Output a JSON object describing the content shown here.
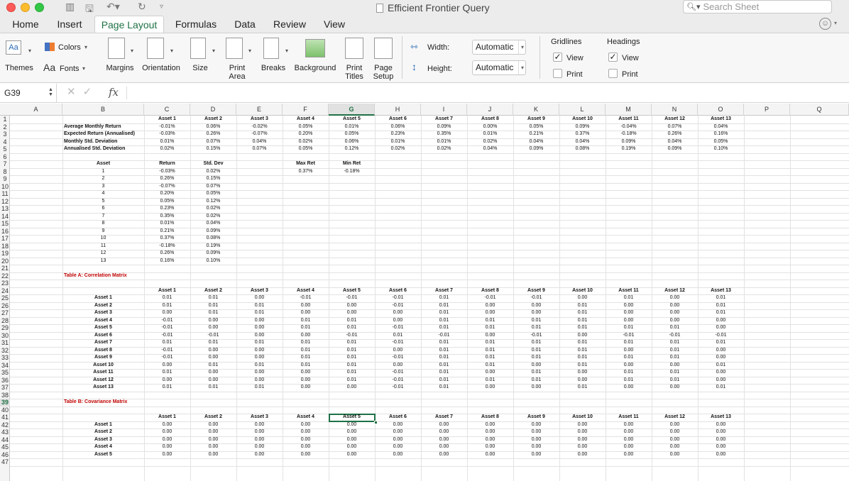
{
  "window": {
    "title": "Efficient Frontier Query"
  },
  "search": {
    "placeholder": "Search Sheet"
  },
  "ribbon_tabs": [
    "Home",
    "Insert",
    "Page Layout",
    "Formulas",
    "Data",
    "Review",
    "View"
  ],
  "active_tab": "Page Layout",
  "ribbon": {
    "themes": "Themes",
    "colors": "Colors",
    "fonts": "Fonts",
    "margins": "Margins",
    "orientation": "Orientation",
    "size": "Size",
    "print_area": "Print Area",
    "breaks": "Breaks",
    "background": "Background",
    "print_titles": "Print Titles",
    "page_setup": "Page Setup",
    "width_label": "Width:",
    "width_value": "Automatic",
    "height_label": "Height:",
    "height_value": "Automatic",
    "gridlines": "Gridlines",
    "headings": "Headings",
    "view": "View",
    "print": "Print",
    "gridlines_view_checked": true,
    "gridlines_print_checked": false,
    "headings_view_checked": true,
    "headings_print_checked": false
  },
  "formula_bar": {
    "name_box": "G39",
    "fx": "fx",
    "value": ""
  },
  "columns": [
    "A",
    "B",
    "C",
    "D",
    "E",
    "F",
    "G",
    "H",
    "I",
    "J",
    "K",
    "L",
    "M",
    "N",
    "O",
    "P",
    "Q"
  ],
  "selected_column": "G",
  "selected_row": "39",
  "rows": [
    "1",
    "2",
    "3",
    "4",
    "5",
    "6",
    "7",
    "8",
    "9",
    "10",
    "11",
    "12",
    "13",
    "14",
    "15",
    "16",
    "17",
    "18",
    "19",
    "20",
    "21",
    "22",
    "23",
    "24",
    "25",
    "26",
    "27",
    "28",
    "29",
    "30",
    "31",
    "32",
    "33",
    "34",
    "35",
    "36",
    "37",
    "38",
    "39",
    "40",
    "41",
    "42",
    "43",
    "44",
    "45",
    "46",
    "47"
  ],
  "assets": [
    "Asset 1",
    "Asset 2",
    "Asset 3",
    "Asset 4",
    "Asset 5",
    "Asset 6",
    "Asset 7",
    "Asset 8",
    "Asset 9",
    "Asset 10",
    "Asset 11",
    "Asset 12",
    "Asset 13"
  ],
  "stats": {
    "labels": [
      "Average Monthly Return",
      "Expected Return (Annualised)",
      "Monthly Std. Deviation",
      "Annualised Std. Deviation"
    ],
    "values": [
      [
        "-0.01%",
        "0.06%",
        "-0.02%",
        "0.05%",
        "0.01%",
        "0.06%",
        "0.09%",
        "0.00%",
        "0.05%",
        "0.09%",
        "-0.04%",
        "0.07%",
        "0.04%"
      ],
      [
        "-0.03%",
        "0.26%",
        "-0.07%",
        "0.20%",
        "0.05%",
        "0.23%",
        "0.35%",
        "0.01%",
        "0.21%",
        "0.37%",
        "-0.18%",
        "0.26%",
        "0.16%"
      ],
      [
        "0.01%",
        "0.07%",
        "0.04%",
        "0.02%",
        "0.06%",
        "0.01%",
        "0.01%",
        "0.02%",
        "0.04%",
        "0.04%",
        "0.09%",
        "0.04%",
        "0.05%"
      ],
      [
        "0.02%",
        "0.15%",
        "0.07%",
        "0.05%",
        "0.12%",
        "0.02%",
        "0.02%",
        "0.04%",
        "0.09%",
        "0.08%",
        "0.19%",
        "0.09%",
        "0.10%"
      ]
    ]
  },
  "summary": {
    "header_asset": "Asset",
    "header_return": "Return",
    "header_std": "Std. Dev",
    "header_max": "Max Ret",
    "header_min": "Min Ret",
    "max_ret": "0.37%",
    "min_ret": "-0.18%",
    "rows": [
      [
        "1",
        "-0.03%",
        "0.02%"
      ],
      [
        "2",
        "0.26%",
        "0.15%"
      ],
      [
        "3",
        "-0.07%",
        "0.07%"
      ],
      [
        "4",
        "0.20%",
        "0.05%"
      ],
      [
        "5",
        "0.05%",
        "0.12%"
      ],
      [
        "6",
        "0.23%",
        "0.02%"
      ],
      [
        "7",
        "0.35%",
        "0.02%"
      ],
      [
        "8",
        "0.01%",
        "0.04%"
      ],
      [
        "9",
        "0.21%",
        "0.09%"
      ],
      [
        "10",
        "0.37%",
        "0.08%"
      ],
      [
        "11",
        "-0.18%",
        "0.19%"
      ],
      [
        "12",
        "0.26%",
        "0.09%"
      ],
      [
        "13",
        "0.16%",
        "0.10%"
      ]
    ]
  },
  "table_a": {
    "title": "Table A: Correlation Matrix",
    "rows": [
      [
        "0.01",
        "0.01",
        "0.00",
        "-0.01",
        "-0.01",
        "-0.01",
        "0.01",
        "-0.01",
        "-0.01",
        "0.00",
        "0.01",
        "0.00",
        "0.01"
      ],
      [
        "0.01",
        "0.01",
        "0.01",
        "0.00",
        "0.00",
        "-0.01",
        "0.01",
        "0.00",
        "0.00",
        "0.01",
        "0.00",
        "0.00",
        "0.01"
      ],
      [
        "0.00",
        "0.01",
        "0.01",
        "0.00",
        "0.00",
        "0.00",
        "0.01",
        "0.00",
        "0.00",
        "0.01",
        "0.00",
        "0.00",
        "0.01"
      ],
      [
        "-0.01",
        "0.00",
        "0.00",
        "0.01",
        "0.01",
        "0.00",
        "0.01",
        "0.01",
        "0.01",
        "0.01",
        "0.00",
        "0.00",
        "0.00"
      ],
      [
        "-0.01",
        "0.00",
        "0.00",
        "0.01",
        "0.01",
        "-0.01",
        "0.01",
        "0.01",
        "0.01",
        "0.01",
        "0.01",
        "0.01",
        "0.00"
      ],
      [
        "-0.01",
        "-0.01",
        "0.00",
        "0.00",
        "-0.01",
        "0.01",
        "-0.01",
        "0.00",
        "-0.01",
        "0.00",
        "-0.01",
        "-0.01",
        "-0.01"
      ],
      [
        "0.01",
        "0.01",
        "0.01",
        "0.01",
        "0.01",
        "-0.01",
        "0.01",
        "0.01",
        "0.01",
        "0.01",
        "0.01",
        "0.01",
        "0.01"
      ],
      [
        "-0.01",
        "0.00",
        "0.00",
        "0.01",
        "0.01",
        "0.00",
        "0.01",
        "0.01",
        "0.01",
        "0.01",
        "0.00",
        "0.01",
        "0.00"
      ],
      [
        "-0.01",
        "0.00",
        "0.00",
        "0.01",
        "0.01",
        "-0.01",
        "0.01",
        "0.01",
        "0.01",
        "0.01",
        "0.01",
        "0.01",
        "0.00"
      ],
      [
        "0.00",
        "0.01",
        "0.01",
        "0.01",
        "0.01",
        "0.00",
        "0.01",
        "0.01",
        "0.00",
        "0.01",
        "0.00",
        "0.00",
        "0.01"
      ],
      [
        "0.01",
        "0.00",
        "0.00",
        "0.00",
        "0.01",
        "-0.01",
        "0.01",
        "0.00",
        "0.01",
        "0.00",
        "0.01",
        "0.01",
        "0.00"
      ],
      [
        "0.00",
        "0.00",
        "0.00",
        "0.00",
        "0.01",
        "-0.01",
        "0.01",
        "0.01",
        "0.01",
        "0.00",
        "0.01",
        "0.01",
        "0.00"
      ],
      [
        "0.01",
        "0.01",
        "0.01",
        "0.00",
        "0.00",
        "-0.01",
        "0.01",
        "0.00",
        "0.00",
        "0.01",
        "0.00",
        "0.00",
        "0.01"
      ]
    ]
  },
  "table_b": {
    "title": "Table B: Covariance Matrix",
    "row_labels": [
      "Asset 1",
      "Asset 2",
      "Asset 3",
      "Asset 4",
      "Asset 5"
    ],
    "cell_value": "0.00"
  }
}
